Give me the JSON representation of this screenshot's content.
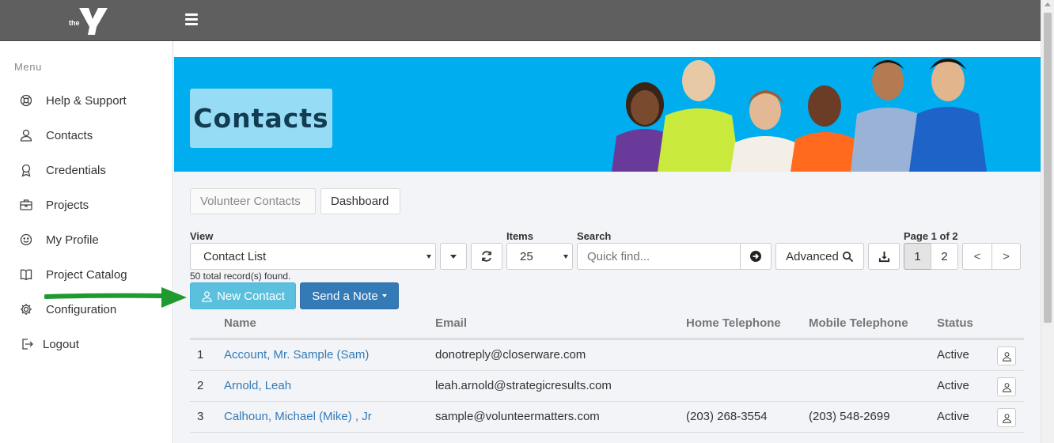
{
  "logo": {
    "text": "the"
  },
  "sidebar": {
    "menu_title": "Menu",
    "items": [
      {
        "label": "Help & Support",
        "icon": "lifebuoy-icon"
      },
      {
        "label": "Contacts",
        "icon": "user-icon"
      },
      {
        "label": "Credentials",
        "icon": "award-icon"
      },
      {
        "label": "Projects",
        "icon": "briefcase-icon"
      },
      {
        "label": "My Profile",
        "icon": "smiley-icon"
      },
      {
        "label": "Project Catalog",
        "icon": "book-icon"
      },
      {
        "label": "Configuration",
        "icon": "gear-icon"
      },
      {
        "label": "Logout",
        "icon": "logout-icon"
      }
    ]
  },
  "banner": {
    "title": "Contacts"
  },
  "tabs": {
    "volunteer_contacts": "Volunteer Contacts",
    "dashboard": "Dashboard"
  },
  "toolbar": {
    "view_label": "View",
    "view_value": "Contact List",
    "items_label": "Items",
    "items_value": "25",
    "search_label": "Search",
    "search_placeholder": "Quick find...",
    "advanced_label": "Advanced",
    "page_label": "Page 1 of 2",
    "pages": [
      "1",
      "2"
    ],
    "prev": "<",
    "next": ">"
  },
  "records_found": "50 total record(s) found.",
  "buttons": {
    "new_contact": "New Contact",
    "send_note": "Send a Note"
  },
  "table": {
    "headers": {
      "name": "Name",
      "email": "Email",
      "home": "Home Telephone",
      "mobile": "Mobile Telephone",
      "status": "Status"
    },
    "rows": [
      {
        "num": "1",
        "name": "Account, Mr. Sample (Sam)",
        "email": "donotreply@closerware.com",
        "home": "",
        "mobile": "",
        "status": "Active"
      },
      {
        "num": "2",
        "name": "Arnold, Leah",
        "email": "leah.arnold@strategicresults.com",
        "home": "",
        "mobile": "",
        "status": "Active"
      },
      {
        "num": "3",
        "name": "Calhoun, Michael (Mike) , Jr",
        "email": "sample@volunteermatters.com",
        "home": "(203) 268-3554",
        "mobile": "(203) 548-2699",
        "status": "Active"
      }
    ]
  },
  "colors": {
    "topbar": "#5f5f5f",
    "banner": "#00aeef",
    "primary": "#337ab7",
    "info": "#5bc0de",
    "arrow": "#1f9a2e"
  }
}
